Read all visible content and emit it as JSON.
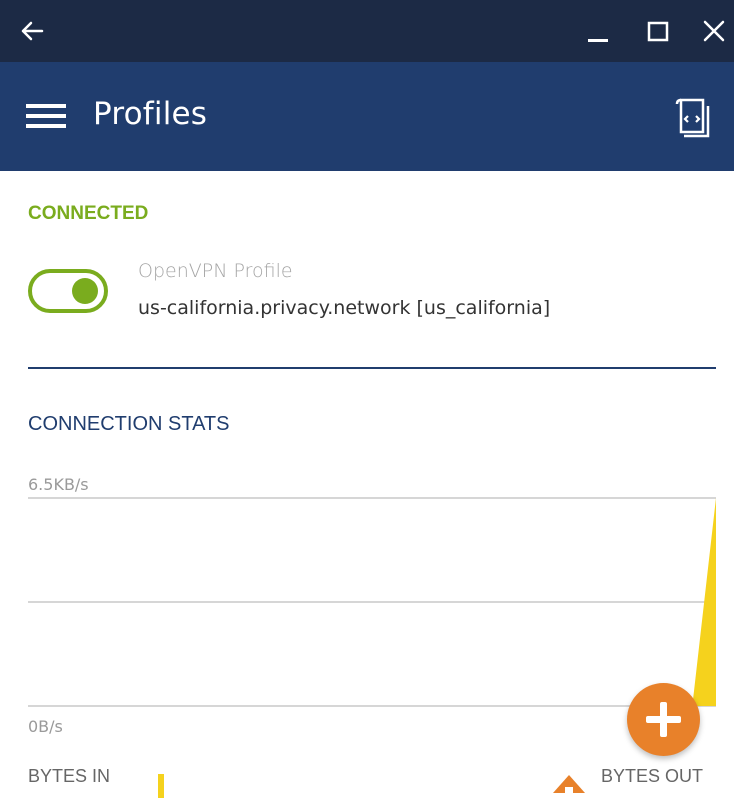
{
  "window": {
    "back_icon": "arrow-left-icon",
    "minimize_icon": "minimize-icon",
    "maximize_icon": "maximize-icon",
    "close_icon": "close-icon"
  },
  "appbar": {
    "menu_icon": "hamburger-menu-icon",
    "title": "Profiles",
    "import_icon": "import-profile-icon"
  },
  "connection": {
    "status_label": "CONNECTED",
    "toggle_on": true,
    "profile_type": "OpenVPN Profile",
    "profile_name": "us-california.privacy.network [us_california]"
  },
  "stats": {
    "title": "CONNECTION STATS",
    "bytes_in_label": "BYTES IN",
    "bytes_out_label": "BYTES OUT"
  },
  "chart_data": {
    "type": "area",
    "y_tick_labels": [
      "6.5KB/s",
      "0B/s"
    ],
    "series": [
      {
        "color": "#f5d21d",
        "values": [
          0,
          0,
          0,
          0,
          0,
          0,
          0,
          0,
          0,
          0,
          0,
          0,
          0,
          0,
          0,
          0,
          0,
          0,
          0,
          0,
          0,
          0,
          0,
          0,
          0,
          0,
          0,
          0,
          0,
          6.5
        ]
      }
    ],
    "ylim": [
      0,
      6.5
    ],
    "grid": true
  },
  "fab": {
    "icon": "plus-icon"
  },
  "colors": {
    "titlebar": "#1c2a45",
    "appbar": "#203d6e",
    "connected": "#7aac1e",
    "bytes_in": "#f5d21d",
    "bytes_out": "#e8812a"
  }
}
